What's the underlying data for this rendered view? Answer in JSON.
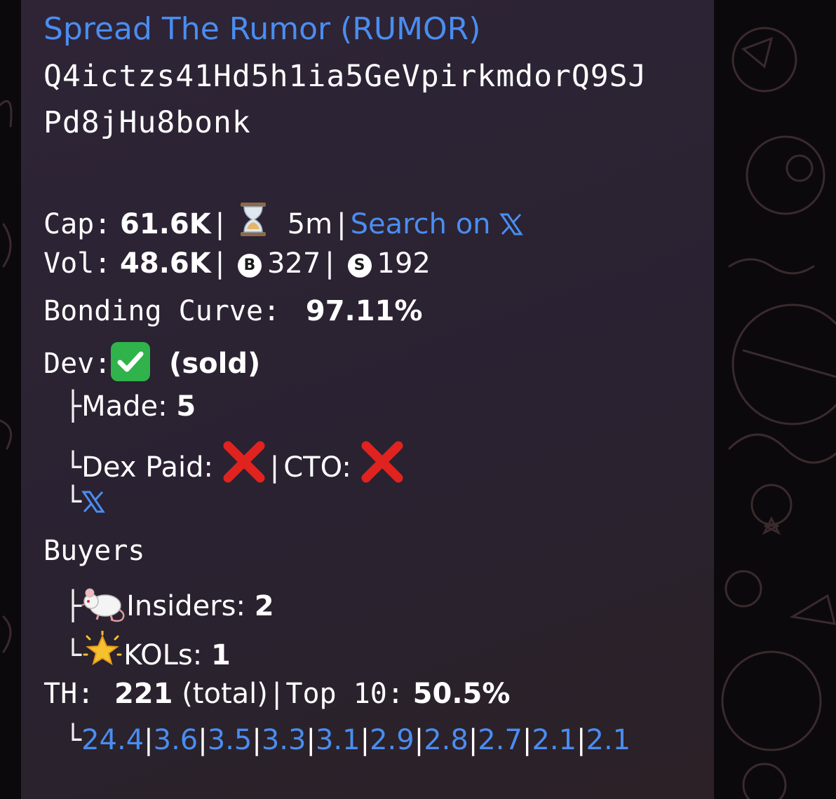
{
  "token": {
    "title": "Spread The Rumor (RUMOR)",
    "address_line1": "Q4ictzs41Hd5h1ia5GeVpirkmdorQ9SJ",
    "address_line2": "Pd8jHu8bonk"
  },
  "cap": {
    "label": "Cap:",
    "value": "61.6K",
    "age": "5m",
    "search_link": "Search on"
  },
  "vol": {
    "label": "Vol:",
    "value": "48.6K",
    "buys_badge": "B",
    "buys": "327",
    "sells_badge": "S",
    "sells": "192"
  },
  "bonding": {
    "label": "Bonding Curve:",
    "value": "97.11%"
  },
  "dev": {
    "label": "Dev:",
    "status": "(sold)",
    "made_label": "Made:",
    "made_value": "5",
    "dex_paid_label": "Dex Paid:",
    "cto_label": "CTO:"
  },
  "buyers": {
    "label": "Buyers",
    "insiders_label": "Insiders:",
    "insiders_value": "2",
    "kols_label": "KOLs:",
    "kols_value": "1"
  },
  "holders": {
    "label": "TH:",
    "total_value": "221",
    "total_suffix": "(total)",
    "top10_label": "Top 10:",
    "top10_value": "50.5%",
    "top_values": [
      "24.4",
      "3.6",
      "3.5",
      "3.3",
      "3.1",
      "2.9",
      "2.8",
      "2.7",
      "2.1",
      "2.1"
    ]
  },
  "tree_glyphs": {
    "branch": "├",
    "end": "└"
  },
  "colors": {
    "link": "#4a8df0",
    "bubble": "#2b2231",
    "check_green": "#2fb34a",
    "cross_red": "#e0231f"
  },
  "icons": [
    "hourglass-icon",
    "x-logo-icon",
    "check-mark-icon",
    "cross-mark-icon",
    "rat-icon",
    "glowing-star-icon"
  ]
}
